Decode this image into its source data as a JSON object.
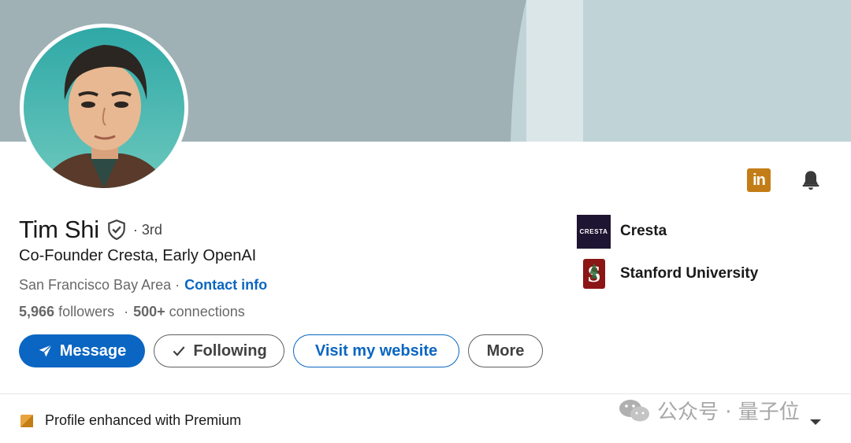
{
  "profile": {
    "name": "Tim Shi",
    "degree": "· 3rd",
    "headline": "Co-Founder Cresta, Early OpenAI",
    "location": "San Francisco Bay Area ·",
    "contact_label": "Contact info",
    "followers_count": "5,966",
    "followers_label": "followers",
    "stats_separator": "·",
    "connections_count": "500+",
    "connections_label": "connections"
  },
  "actions": {
    "message": "Message",
    "following": "Following",
    "website": "Visit my website",
    "more": "More"
  },
  "orgs": [
    {
      "logo_text": "CRESTA",
      "name": "Cresta"
    },
    {
      "logo_text": "S",
      "name": "Stanford University"
    }
  ],
  "top_icons": {
    "linkedin_text": "in",
    "linkedin_color": "#c37d16",
    "bell": "bell-icon"
  },
  "footer": {
    "premium_text": "Profile enhanced with Premium"
  },
  "watermark": {
    "text": "公众号 · 量子位"
  },
  "colors": {
    "accent": "#0a66c2",
    "premium": "#c37d16",
    "banner": "#9fb1b5"
  }
}
